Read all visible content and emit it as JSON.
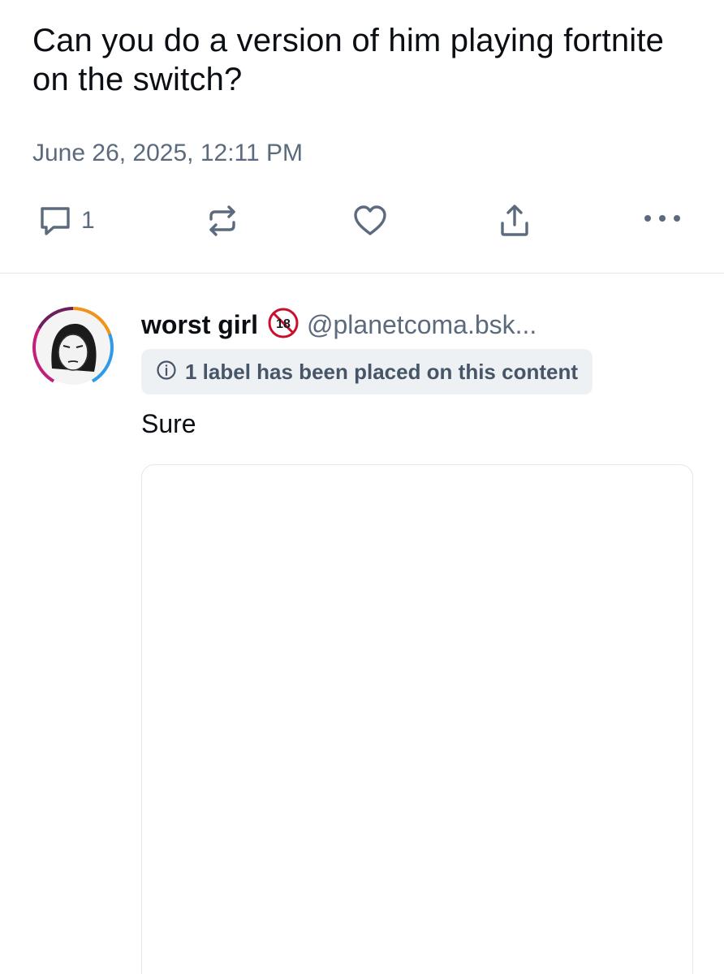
{
  "post": {
    "text": "Can you do a version of him playing fortnite on the switch?",
    "timestamp": "June 26, 2025, 12:11 PM",
    "actions": {
      "reply_count": "1",
      "reply_icon": "reply-icon",
      "repost_icon": "repost-icon",
      "like_icon": "heart-icon",
      "share_icon": "share-icon",
      "more_icon": "more-icon"
    }
  },
  "reply": {
    "display_name": "worst girl",
    "badge": "18",
    "handle": "@planetcoma.bsk...",
    "label_notice": "1 label has been placed on this content",
    "text": "Sure"
  },
  "colors": {
    "text": "#0b0f14",
    "muted": "#5b6b7d",
    "pill_bg": "#eef1f4",
    "badge_red": "#c8102e"
  }
}
